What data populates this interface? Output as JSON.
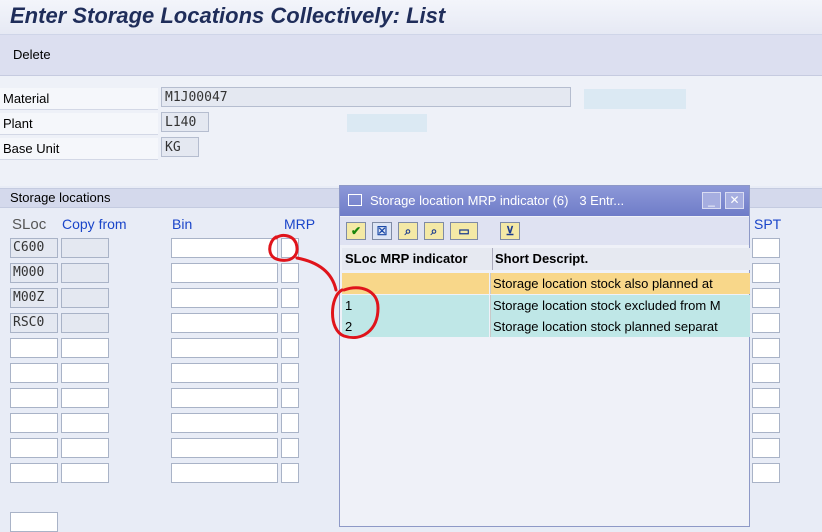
{
  "window": {
    "title": "Enter Storage Locations Collectively: List"
  },
  "toolbar": {
    "delete_label": "Delete"
  },
  "header": {
    "material_label": "Material",
    "material_value": "M1J00047",
    "plant_label": "Plant",
    "plant_value": "L140",
    "base_unit_label": "Base Unit",
    "base_unit_value": "KG"
  },
  "storage": {
    "section_title": "Storage locations",
    "columns": {
      "sloc": "SLoc",
      "copy_from": "Copy from",
      "bin": "Bin",
      "mrp": "MRP",
      "spt": "SPT"
    },
    "rows": [
      "C600",
      "M000",
      "M00Z",
      "RSC0",
      "",
      "",
      "",
      "",
      "",
      ""
    ]
  },
  "popup": {
    "title": "Storage location MRP indicator (6)",
    "entries": "3 Entr...",
    "col_indicator": "SLoc MRP indicator",
    "col_desc": "Short Descript.",
    "rows": [
      {
        "key": "",
        "desc": "Storage location stock also planned at"
      },
      {
        "key": "1",
        "desc": "Storage location stock excluded from M"
      },
      {
        "key": "2",
        "desc": "Storage location stock planned separat"
      }
    ]
  },
  "colors": {
    "accent": "#1a45c9",
    "selected_row": "#f8d78a",
    "alt_row": "#bfe7e7",
    "annotation": "#e0141b"
  }
}
